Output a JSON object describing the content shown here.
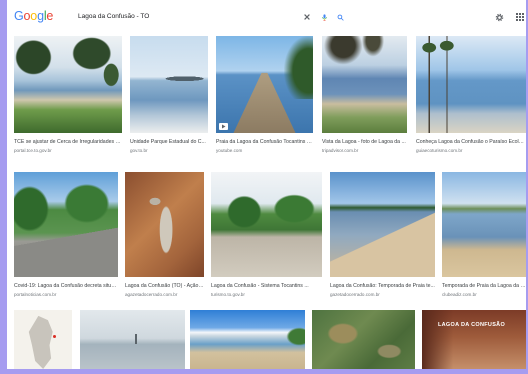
{
  "header": {
    "logo_letters": [
      "G",
      "o",
      "o",
      "g",
      "l",
      "e"
    ],
    "logo_colors": [
      "#4285F4",
      "#EA4335",
      "#FBBC05",
      "#4285F4",
      "#34A853",
      "#EA4335"
    ],
    "search_query": "Lagoa da Confusão - TO",
    "search_icons": [
      "clear-icon",
      "mic-icon",
      "search-icon"
    ],
    "right_icons": [
      "gear-icon",
      "apps-icon"
    ]
  },
  "results": {
    "row1": [
      {
        "title": "TCE se ajustar de Cerca de Irregularidades n...",
        "source": "portal.tce.to.gov.br"
      },
      {
        "title": "Unidade Parque Estadual do C...",
        "source": "gov.to.br"
      },
      {
        "title": "Praia da Lagoa da Confusão Tocantins - ...",
        "source": "youtube.com",
        "badge_icon": "play-icon"
      },
      {
        "title": "Vista da Lagoa - foto de Lagoa da ...",
        "source": "tripadvisor.com.br"
      },
      {
        "title": "Conheça Lagoa da Confusão o Paraíso Ecológico ...",
        "source": "guiaecoturismo.com.br"
      }
    ],
    "row2": [
      {
        "title": "Covid-19: Lagoa da Confusão decreta situa...",
        "source": "portalnoticias.com.br"
      },
      {
        "title": "Lagoa da Confusão (TO) - Ação ...",
        "source": "agazetadocerrado.com.br"
      },
      {
        "title": "Lagoa da Confusão - Sistema Tocantins ...",
        "source": "turismo.to.gov.br"
      },
      {
        "title": "Lagoa da Confusão: Temporada de Praia te...",
        "source": "gazetadocerrado.com.br"
      },
      {
        "title": "Temporada de Praia da Lagoa da Confusão ...",
        "source": "clubeadiz.com.br"
      }
    ],
    "row3": [
      {},
      {},
      {},
      {},
      {
        "overlay_text": "LAGOA DA CONFUSÃO"
      }
    ]
  },
  "colors": {
    "frame": "#a69cf0",
    "caption_title": "#3c4043",
    "caption_source": "#70757a",
    "accent_blue": "#4285F4"
  }
}
